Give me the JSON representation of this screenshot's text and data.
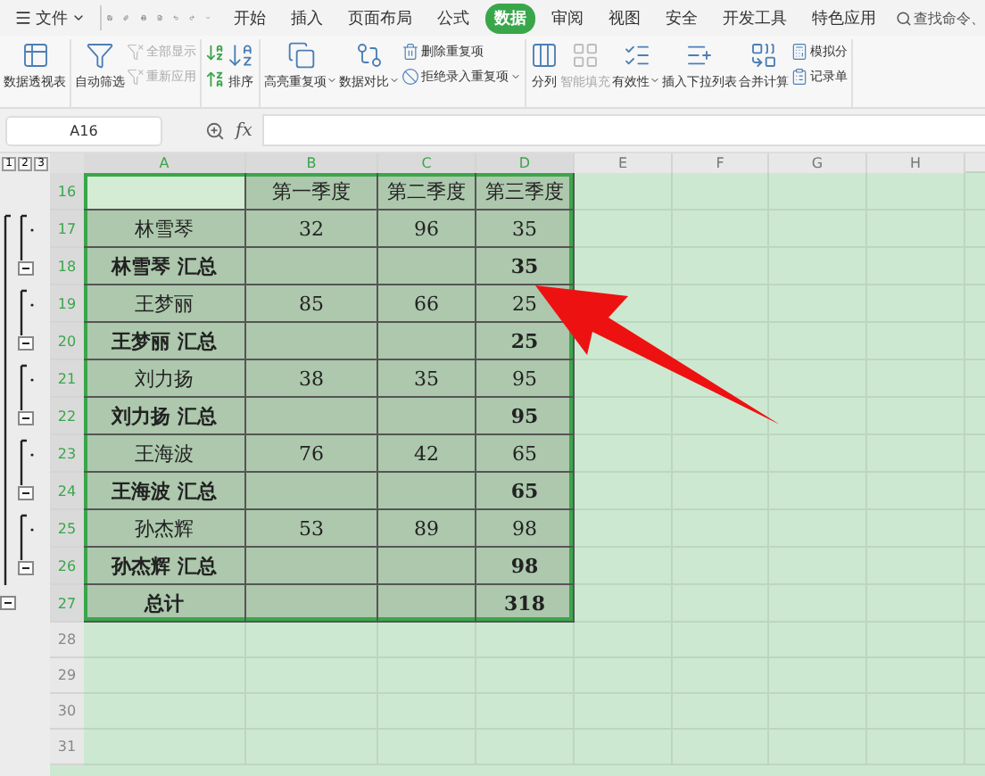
{
  "menu": {
    "label": "文件"
  },
  "tabs": [
    {
      "label": "开始",
      "selected": false
    },
    {
      "label": "插入",
      "selected": false
    },
    {
      "label": "页面布局",
      "selected": false
    },
    {
      "label": "公式",
      "selected": false
    },
    {
      "label": "数据",
      "selected": true
    },
    {
      "label": "审阅",
      "selected": false
    },
    {
      "label": "视图",
      "selected": false
    },
    {
      "label": "安全",
      "selected": false
    },
    {
      "label": "开发工具",
      "selected": false
    },
    {
      "label": "特色应用",
      "selected": false
    }
  ],
  "search": {
    "placeholder": "查找命令、"
  },
  "ribbon": [
    {
      "items": [
        {
          "kind": "large",
          "label": "数据透视表",
          "disabled": false
        }
      ]
    },
    {
      "items": [
        {
          "kind": "large",
          "label": "自动筛选",
          "disabled": false
        },
        {
          "kind": "stack",
          "items": [
            {
              "label": "全部显示",
              "disabled": true
            },
            {
              "label": "重新应用",
              "disabled": true
            }
          ]
        }
      ]
    },
    {
      "items": [
        {
          "kind": "sort",
          "label": "排序",
          "disabled": false
        }
      ]
    },
    {
      "items": [
        {
          "kind": "large",
          "label": "高亮重复项",
          "dropdown": true,
          "disabled": false
        },
        {
          "kind": "large",
          "label": "数据对比",
          "dropdown": true,
          "disabled": false
        },
        {
          "kind": "stack",
          "items": [
            {
              "label": "删除重复项",
              "disabled": false
            },
            {
              "label": "拒绝录入重复项",
              "dropdown": true,
              "disabled": false
            }
          ]
        }
      ]
    },
    {
      "items": [
        {
          "kind": "large",
          "label": "分列",
          "disabled": false
        },
        {
          "kind": "large",
          "label": "智能填充",
          "disabled": true
        },
        {
          "kind": "large",
          "label": "有效性",
          "dropdown": true,
          "disabled": false
        },
        {
          "kind": "large",
          "label": "插入下拉列表",
          "disabled": false
        },
        {
          "kind": "large",
          "label": "合并计算",
          "disabled": false
        },
        {
          "kind": "stack",
          "items": [
            {
              "label": "模拟分",
              "disabled": false
            },
            {
              "label": "记录单",
              "disabled": false
            }
          ]
        }
      ]
    }
  ],
  "formula_bar": {
    "cell_ref": "A16",
    "fx": "fx"
  },
  "outline_levels": [
    "1",
    "2",
    "3"
  ],
  "columns": [
    {
      "label": "A",
      "selected": true
    },
    {
      "label": "B",
      "selected": true
    },
    {
      "label": "C",
      "selected": true
    },
    {
      "label": "D",
      "selected": true
    },
    {
      "label": "E",
      "selected": false
    },
    {
      "label": "F",
      "selected": false
    },
    {
      "label": "G",
      "selected": false
    },
    {
      "label": "H",
      "selected": false
    }
  ],
  "rows": [
    {
      "number": "16",
      "kind": "header",
      "selected": true,
      "active": true,
      "cells": [
        "",
        "第一季度",
        "第二季度",
        "第三季度"
      ]
    },
    {
      "number": "17",
      "kind": "detail",
      "selected": true,
      "cells": [
        "林雪琴",
        "32",
        "96",
        "35"
      ]
    },
    {
      "number": "18",
      "kind": "subtotal",
      "selected": true,
      "cells": [
        "林雪琴 汇总",
        "",
        "",
        "35"
      ]
    },
    {
      "number": "19",
      "kind": "detail",
      "selected": true,
      "cells": [
        "王梦丽",
        "85",
        "66",
        "25"
      ]
    },
    {
      "number": "20",
      "kind": "subtotal",
      "selected": true,
      "cells": [
        "王梦丽 汇总",
        "",
        "",
        "25"
      ]
    },
    {
      "number": "21",
      "kind": "detail",
      "selected": true,
      "cells": [
        "刘力扬",
        "38",
        "35",
        "95"
      ]
    },
    {
      "number": "22",
      "kind": "subtotal",
      "selected": true,
      "cells": [
        "刘力扬 汇总",
        "",
        "",
        "95"
      ]
    },
    {
      "number": "23",
      "kind": "detail",
      "selected": true,
      "cells": [
        "王海波",
        "76",
        "42",
        "65"
      ]
    },
    {
      "number": "24",
      "kind": "subtotal",
      "selected": true,
      "cells": [
        "王海波 汇总",
        "",
        "",
        "65"
      ]
    },
    {
      "number": "25",
      "kind": "detail",
      "selected": true,
      "cells": [
        "孙杰辉",
        "53",
        "89",
        "98"
      ]
    },
    {
      "number": "26",
      "kind": "subtotal",
      "selected": true,
      "cells": [
        "孙杰辉 汇总",
        "",
        "",
        "98"
      ]
    },
    {
      "number": "27",
      "kind": "total",
      "selected": true,
      "cells": [
        "总计",
        "",
        "",
        "318"
      ]
    },
    {
      "number": "28",
      "kind": "empty",
      "selected": false
    },
    {
      "number": "29",
      "kind": "empty",
      "selected": false
    },
    {
      "number": "30",
      "kind": "empty",
      "selected": false
    },
    {
      "number": "31",
      "kind": "empty",
      "selected": false
    }
  ]
}
